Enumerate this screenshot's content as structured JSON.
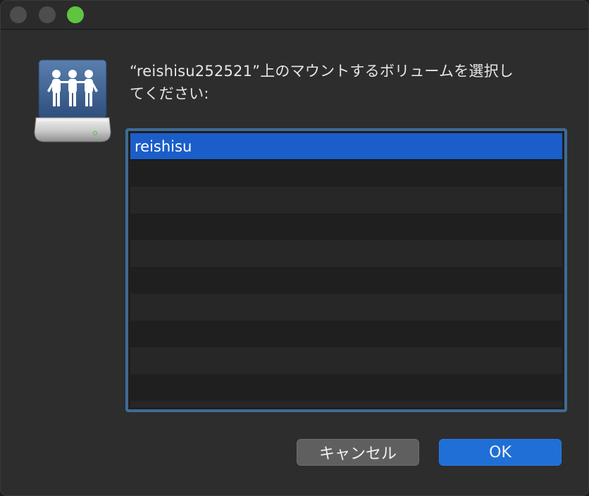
{
  "window": {
    "title_buttons": [
      "close",
      "minimize",
      "zoom"
    ],
    "accent_color": "#1b5ec9"
  },
  "dialog": {
    "icon": "network-share-drive-icon",
    "prompt_line1": "“reishisu252521”上のマウントするボリュームを選択し",
    "prompt_line2": "てください:",
    "volumes": [
      "reishisu"
    ],
    "selected_volume": "reishisu",
    "cancel_label": "キャンセル",
    "ok_label": "OK"
  }
}
